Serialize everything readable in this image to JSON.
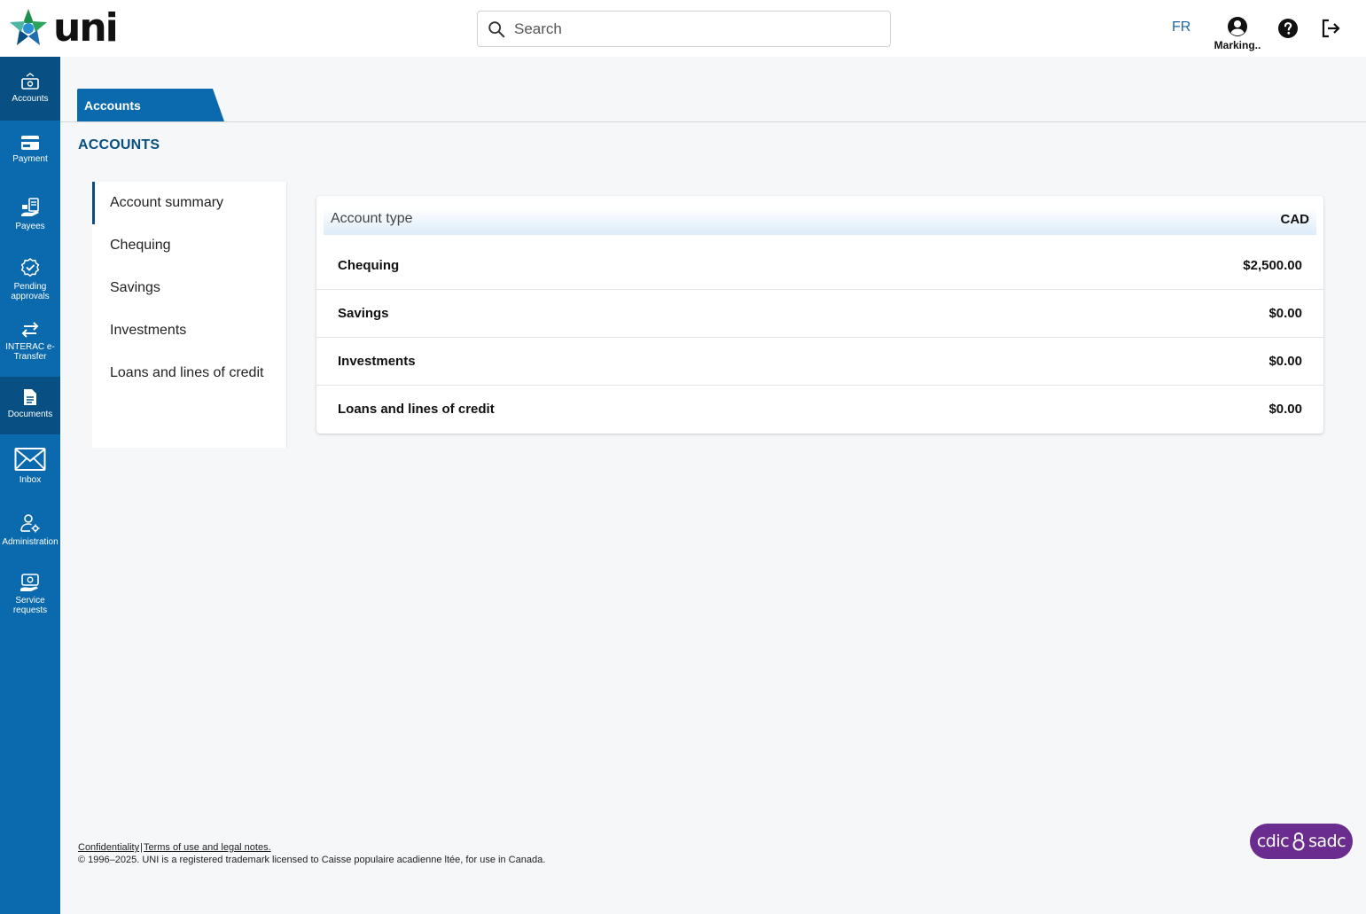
{
  "header": {
    "logo_text": "uni",
    "search_placeholder": "Search",
    "lang": "FR",
    "profile_name": "Marking..",
    "icons": {
      "search": "search-icon",
      "profile": "account-circle-icon",
      "help": "help-icon",
      "logout": "logout-icon"
    }
  },
  "sidebar": {
    "items": [
      {
        "label": "Accounts",
        "icon": "accounts-icon",
        "active": true
      },
      {
        "label": "Payment",
        "icon": "credit-card-icon"
      },
      {
        "label": "Payees",
        "icon": "payees-icon"
      },
      {
        "label": "Pending approvals",
        "icon": "approval-badge-icon"
      },
      {
        "label": "INTERAC e-Transfer",
        "icon": "transfer-arrows-icon"
      },
      {
        "label": "Documents",
        "icon": "document-icon",
        "active": true
      },
      {
        "label": "Inbox",
        "icon": "envelope-icon"
      },
      {
        "label": "Administration",
        "icon": "user-settings-icon"
      },
      {
        "label": "Service requests",
        "icon": "service-request-icon"
      }
    ]
  },
  "main": {
    "tab_label": "Accounts",
    "page_title": "ACCOUNTS",
    "subnav": [
      {
        "label": "Account summary",
        "active": true
      },
      {
        "label": "Chequing"
      },
      {
        "label": "Savings"
      },
      {
        "label": "Investments"
      },
      {
        "label": "Loans and lines of credit"
      }
    ],
    "summary": {
      "header_label": "Account type",
      "currency": "CAD",
      "rows": [
        {
          "name": "Chequing",
          "amount": "$2,500.00"
        },
        {
          "name": "Savings",
          "amount": "$0.00"
        },
        {
          "name": "Investments",
          "amount": "$0.00"
        },
        {
          "name": "Loans and lines of credit",
          "amount": "$0.00"
        }
      ]
    }
  },
  "footer": {
    "confidentiality": "Confidentiality",
    "separator": "|",
    "terms": "Terms of use and legal notes.",
    "copyright": "© 1996–2025. UNI is a registered trademark licensed to Caisse populaire acadienne ltée, for use in Canada."
  },
  "badge": {
    "left": "cdic",
    "right": "sadc"
  },
  "colors": {
    "sidebar": "#0a6aad",
    "sidebar_active": "#084f84",
    "title": "#0a4f83",
    "badge": "#6b2c8f"
  }
}
